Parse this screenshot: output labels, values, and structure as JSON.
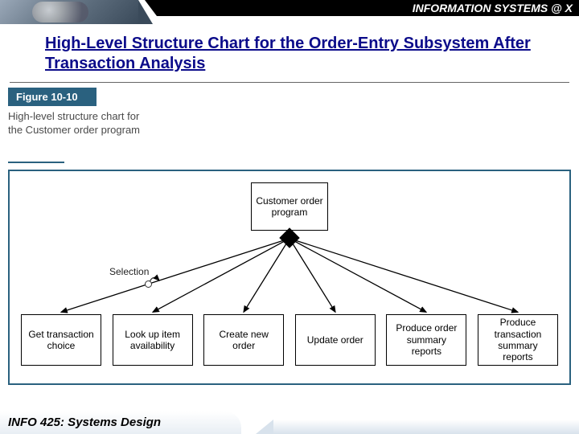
{
  "header": {
    "brand": "INFORMATION SYSTEMS @ X"
  },
  "title": "High-Level Structure Chart for the Order-Entry Subsystem After Transaction Analysis",
  "figure": {
    "label": "Figure 10-10",
    "caption": "High-level structure chart for the Customer order program"
  },
  "diagram": {
    "root": "Customer order program",
    "selection_label": "Selection",
    "children": [
      "Get transaction choice",
      "Look up item availability",
      "Create new order",
      "Update order",
      "Produce order summary reports",
      "Produce transaction summary reports"
    ]
  },
  "footer": {
    "course": "INFO 425: Systems Design"
  }
}
